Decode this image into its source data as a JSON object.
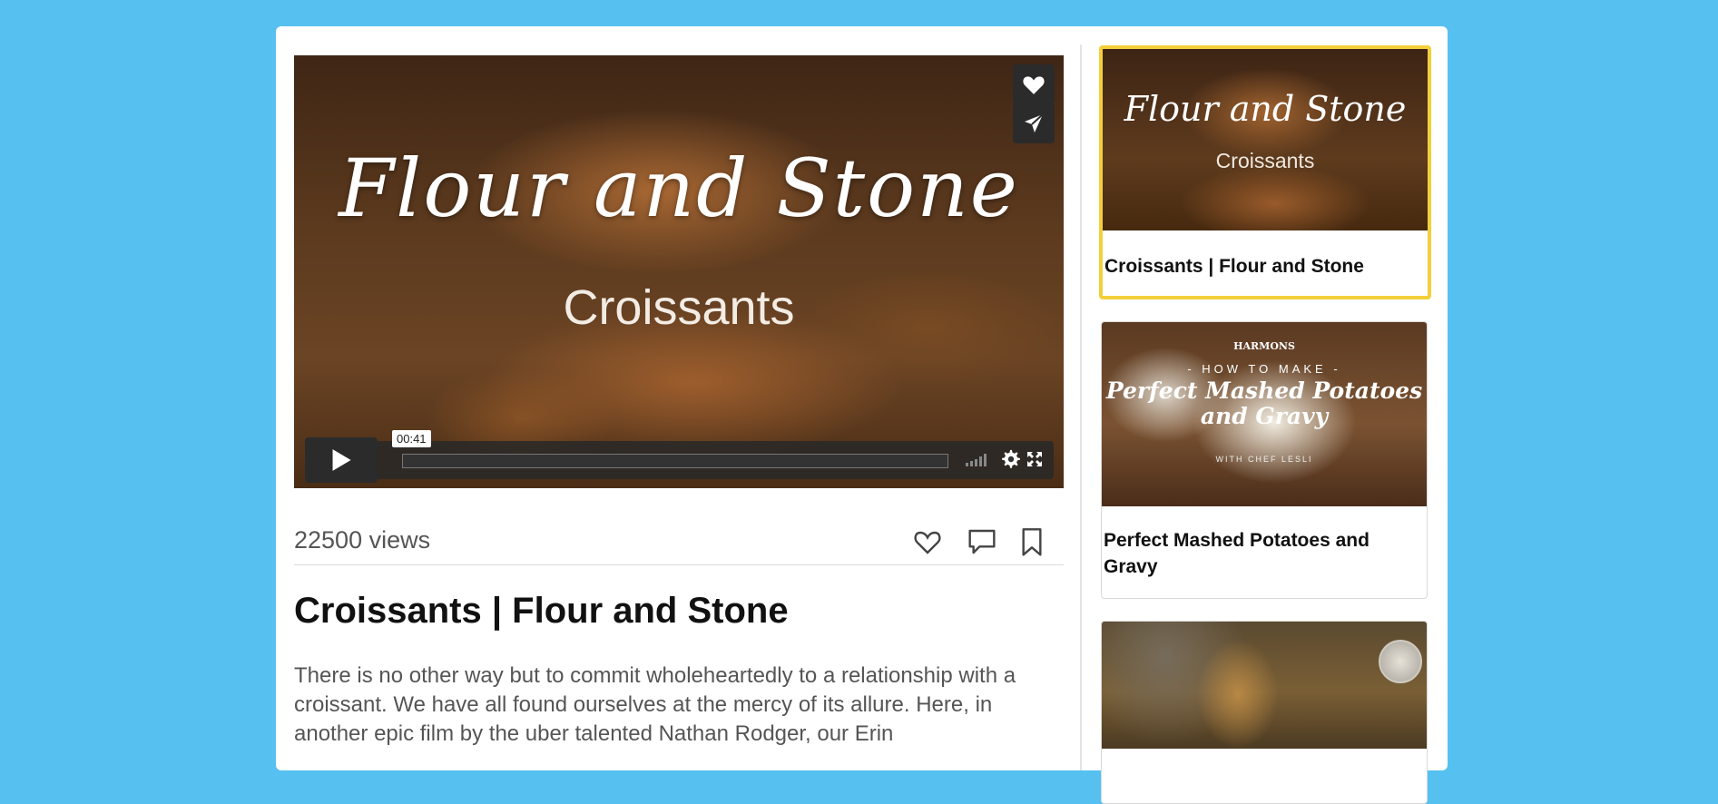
{
  "player": {
    "overlay_script": "Flour and Stone",
    "overlay_subtitle": "Croissants",
    "time_tooltip": "00:41",
    "progress_fraction": 0.0,
    "icons": [
      "heart-icon",
      "send-icon",
      "play-icon",
      "volume-icon",
      "gear-icon",
      "fullscreen-icon"
    ]
  },
  "stats": {
    "views": "22500 views",
    "icons": [
      "heart-outline-icon",
      "comment-icon",
      "bookmark-icon"
    ]
  },
  "video": {
    "title": "Croissants | Flour and Stone",
    "description": "There is no other way but to commit wholeheartedly to a relationship with a croissant. We have all found ourselves at the mercy of its allure. Here, in another epic film by the uber talented Nathan Rodger, our Erin"
  },
  "related": [
    {
      "title": "Croissants | Flour and Stone",
      "thumb_script": "Flour and Stone",
      "thumb_sub": "Croissants",
      "active": true
    },
    {
      "title": "Perfect Mashed Potatoes and Gravy",
      "thumb_brand": "HARMONS",
      "thumb_how": "- HOW TO MAKE -",
      "thumb_big": "Perfect Mashed Potatoes and Gravy",
      "thumb_chef": "WITH CHEF LESLI",
      "active": false
    },
    {
      "title": "",
      "active": false
    }
  ],
  "colors": {
    "page_bg": "#56c1f0",
    "active_border": "#f3cf3a"
  }
}
